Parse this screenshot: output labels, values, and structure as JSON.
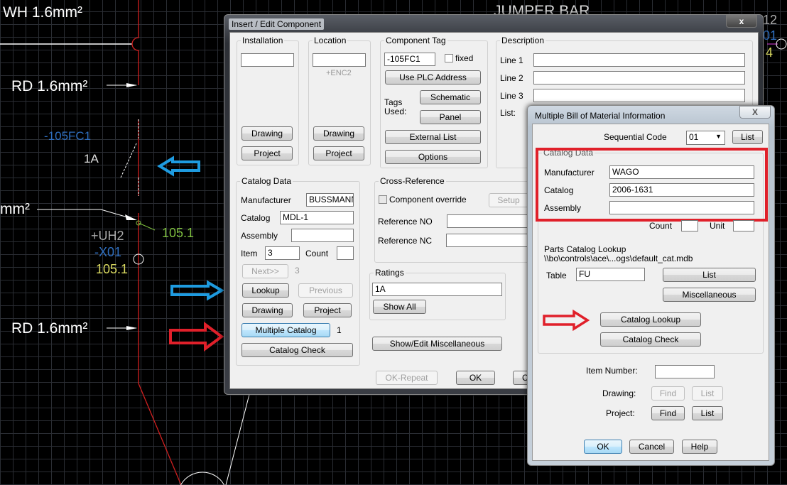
{
  "cad": {
    "labels": {
      "wh": "WH 1.6mm²",
      "rd_top": "RD 1.6mm²",
      "mm": "mm²",
      "rd_bottom": "RD 1.6mm²",
      "jumper": "JUMPER BAR",
      "tag": "-105FC1",
      "rating": "1A",
      "ref_green": "105.1",
      "uh2": "+UH2",
      "x01": "-X01",
      "ref_yellow": "105.1",
      "edge_12": "12",
      "edge_01": "01",
      "edge_4": "4"
    },
    "arrow_colors": {
      "blue": "#1e9be0",
      "red": "#e0202a"
    }
  },
  "main_dialog": {
    "title": "Insert / Edit Component",
    "close": "x",
    "installation": {
      "label": "Installation",
      "value": "",
      "drawing": "Drawing",
      "project": "Project"
    },
    "location": {
      "label": "Location",
      "value": "",
      "hint": "+ENC2",
      "drawing": "Drawing",
      "project": "Project"
    },
    "component_tag": {
      "label": "Component Tag",
      "value": "-105FC1",
      "fixed": "fixed",
      "use_plc": "Use PLC Address",
      "tags_used": "Tags Used:",
      "schematic": "Schematic",
      "panel": "Panel",
      "external_list": "External List",
      "options": "Options"
    },
    "description": {
      "label": "Description",
      "line1": "Line 1",
      "line2": "Line 2",
      "line3": "Line 3",
      "list": "List:",
      "values": [
        "",
        "",
        ""
      ]
    },
    "catalog": {
      "label": "Catalog Data",
      "manufacturer_label": "Manufacturer",
      "manufacturer": "BUSSMANN",
      "catalog_label": "Catalog",
      "catalog": "MDL-1",
      "assembly_label": "Assembly",
      "assembly": "",
      "item_label": "Item",
      "item": "3",
      "count_label": "Count",
      "count": "",
      "next": "Next>>",
      "next_count": "3",
      "lookup": "Lookup",
      "previous": "Previous",
      "drawing": "Drawing",
      "project": "Project",
      "multiple": "Multiple Catalog",
      "multiple_count": "1",
      "check": "Catalog Check"
    },
    "cross_ref": {
      "label": "Cross-Reference",
      "override": "Component override",
      "setup": "Setup",
      "no_label": "Reference NO",
      "nc_label": "Reference NC"
    },
    "ratings": {
      "label": "Ratings",
      "value": "1A",
      "show_all": "Show All"
    },
    "misc": "Show/Edit Miscellaneous",
    "ok_repeat": "OK-Repeat",
    "ok": "OK",
    "cancel": "C"
  },
  "bom_dialog": {
    "title": "Multiple Bill of Material Information",
    "close": "X",
    "seq_label": "Sequential Code",
    "seq_value": "01",
    "seq_list": "List",
    "catalog_label": "Catalog Data",
    "manufacturer_label": "Manufacturer",
    "manufacturer": "WAGO",
    "catalog_field_label": "Catalog",
    "catalog": "2006-1631",
    "assembly_label": "Assembly",
    "assembly": "",
    "count_label": "Count",
    "unit_label": "Unit",
    "lookup_title": "Parts Catalog Lookup",
    "lookup_path": "\\\\bo\\controls\\ace\\...ogs\\default_cat.mdb",
    "table_label": "Table",
    "table": "FU",
    "list": "List",
    "misc": "Miscellaneous",
    "catalog_lookup": "Catalog Lookup",
    "catalog_check": "Catalog Check",
    "item_number_label": "Item Number:",
    "item_number": "",
    "drawing_label": "Drawing:",
    "project_label": "Project:",
    "find": "Find",
    "list2": "List",
    "ok": "OK",
    "cancel": "Cancel",
    "help": "Help",
    "highlight_color": "#e0202a"
  }
}
